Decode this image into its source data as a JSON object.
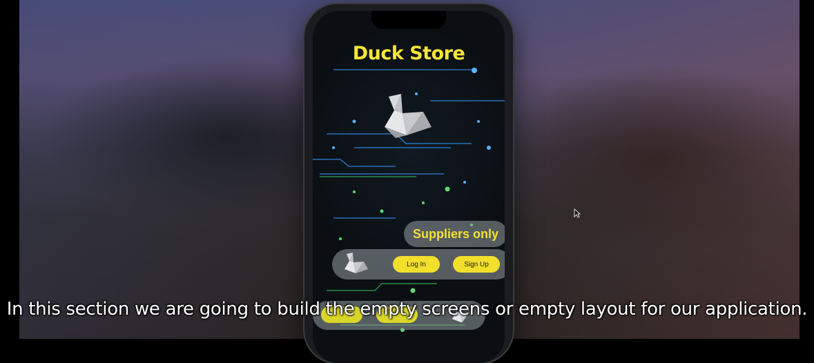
{
  "app": {
    "title": "Duck Store",
    "suppliers_label": "Suppliers only",
    "login_label": "Log In",
    "signup_label": "Sign Up"
  },
  "icons": [
    "origami-swan-icon",
    "mouse-cursor-icon"
  ],
  "colors": {
    "accent": "#f3e036",
    "screen_bg": "#0b0f13",
    "circuit_blue": "#2f7fd8",
    "circuit_green": "#4fd06a"
  },
  "subtitle": "In this section we are going to build the empty screens or empty layout for our application."
}
